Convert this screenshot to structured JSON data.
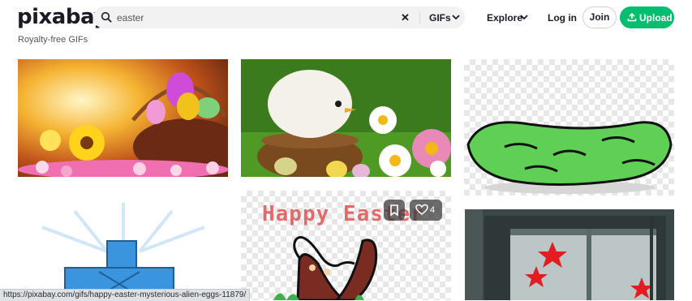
{
  "header": {
    "logo": "pixabay",
    "search": {
      "value": "easter",
      "type": "GIFs"
    },
    "nav": {
      "explore": "Explore",
      "login": "Log in",
      "join": "Join",
      "upload": "Upload"
    }
  },
  "subtitle": "Royalty-free GIFs",
  "results": {
    "hover_tile": {
      "like_count": "4",
      "title_text": "Happy Easter"
    }
  },
  "status_bar": {
    "url": "https://pixabay.com/gifs/happy-easter-mysterious-alien-eggs-11879/"
  },
  "colors": {
    "brand": "#02be6e",
    "text": "#191b26"
  }
}
